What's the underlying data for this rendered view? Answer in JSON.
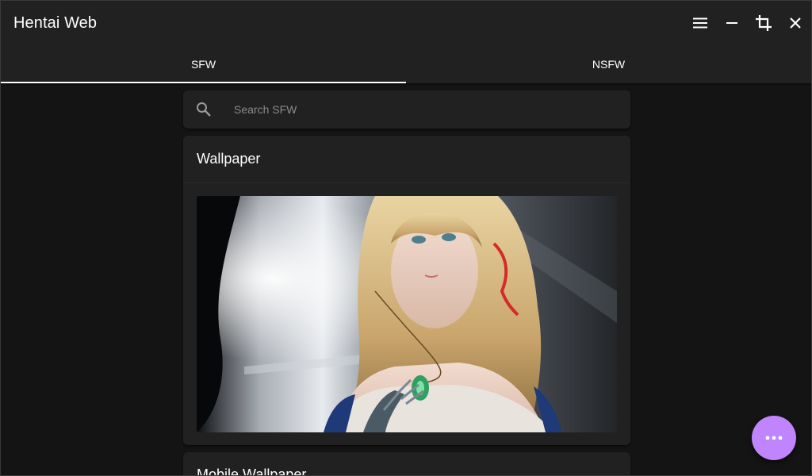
{
  "app": {
    "title": "Hentai Web"
  },
  "window_controls": [
    {
      "name": "menu-icon",
      "label": "Menu"
    },
    {
      "name": "minimize-icon",
      "label": "Minimize"
    },
    {
      "name": "crop-icon",
      "label": "Crop"
    },
    {
      "name": "close-icon",
      "label": "Close"
    }
  ],
  "tabs": [
    {
      "label": "SFW",
      "active": true
    },
    {
      "label": "NSFW",
      "active": false
    }
  ],
  "search": {
    "placeholder": "Search SFW",
    "value": "",
    "icon": "search-icon"
  },
  "cards": [
    {
      "title": "Wallpaper",
      "image": "anime-girl-wallpaper"
    },
    {
      "title": "Mobile Wallpaper"
    }
  ],
  "fab": {
    "icon": "more-horizontal-icon",
    "color": "#c084fc"
  },
  "colors": {
    "surface": "#212121",
    "background": "#141414",
    "accent": "#c084fc",
    "tab_indicator": "#ffffff"
  }
}
